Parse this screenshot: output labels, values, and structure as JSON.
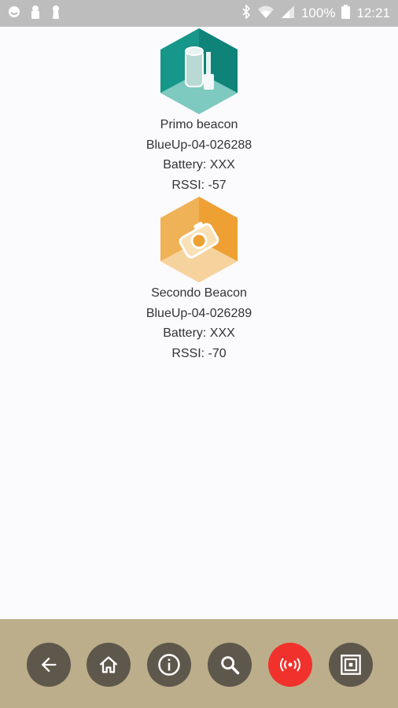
{
  "status_bar": {
    "battery": "100%",
    "time": "12:21",
    "left_icons": [
      "notification-icon",
      "lock-icon",
      "keyhole-icon"
    ],
    "right_icons": [
      "bluetooth-icon",
      "wifi-icon",
      "cell-signal-icon",
      "battery-icon"
    ]
  },
  "beacons": [
    {
      "name": "Primo beacon",
      "id": "BlueUp-04-026288",
      "battery": "Battery: XXX",
      "rssi": "RSSI: -57",
      "icon": "paint-bucket-icon",
      "color": "#17968a"
    },
    {
      "name": "Secondo Beacon",
      "id": "BlueUp-04-026289",
      "battery": "Battery: XXX",
      "rssi": "RSSI: -70",
      "icon": "camera-icon",
      "color": "#eea033"
    }
  ],
  "bottom_nav": {
    "items": [
      "back-icon",
      "home-icon",
      "info-icon",
      "search-icon",
      "broadcast-icon",
      "qr-frame-icon"
    ],
    "active": "broadcast-icon",
    "bar_color": "#bcae8a",
    "button_color": "#5e574c",
    "active_color": "#f1322c"
  }
}
